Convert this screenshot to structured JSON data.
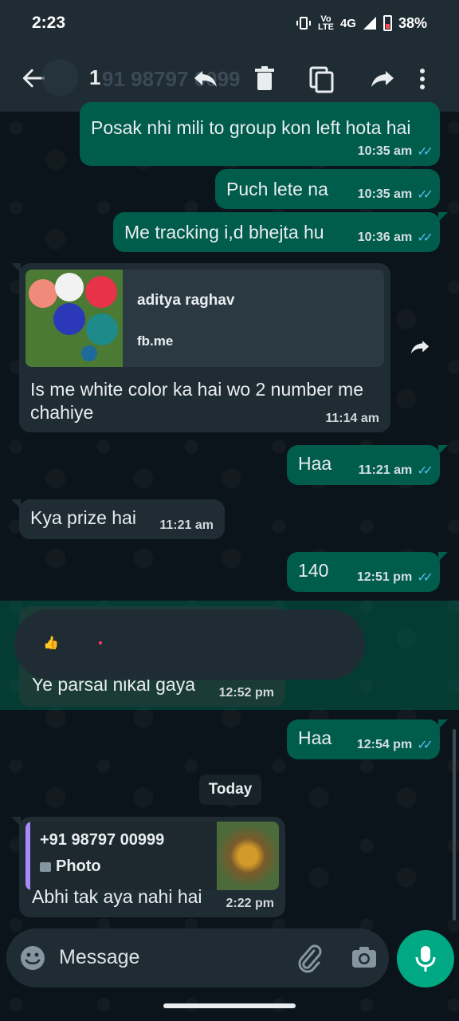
{
  "status_bar": {
    "time": "2:23",
    "network": "4G",
    "battery": "38%"
  },
  "action_bar": {
    "selected_count": "1",
    "contact_ghost": "91 98797 0099"
  },
  "messages": [
    {
      "text": "Posak nhi mili to group kon left hota hai",
      "time": "10:35 am",
      "ticks": "✓✓"
    },
    {
      "text": "Puch lete na",
      "time": "10:35 am",
      "ticks": "✓✓"
    },
    {
      "text": "Me tracking i,d bhejta hu",
      "time": "10:36 am",
      "ticks": "✓✓"
    },
    {
      "preview_name": "aditya raghav",
      "preview_domain": "fb.me",
      "text": "Is me white color ka hai wo 2 number me chahiye",
      "time": "11:14 am"
    },
    {
      "text": "Haa",
      "time": "11:21 am",
      "ticks": "✓✓"
    },
    {
      "text": "Kya prize hai",
      "time": "11:21 am"
    },
    {
      "text": "140",
      "time": "12:51 pm",
      "ticks": "✓✓"
    },
    {
      "text": "Ye parsal nikal gaya",
      "time": "12:52 pm"
    },
    {
      "text": "Haa",
      "time": "12:54 pm",
      "ticks": "✓✓"
    },
    {
      "quote_name": "+91 98797 00999",
      "quote_type": "Photo",
      "text": "Abhi tak aya nahi hai",
      "time": "2:22 pm"
    }
  ],
  "reaction_bar": {
    "emoji": "👍"
  },
  "day_divider": "Today",
  "composer": {
    "placeholder": "Message"
  },
  "colors": {
    "header": "#1f2c34",
    "outgoing_bubble": "#005c4b",
    "incoming_bubble": "#202c33",
    "accent": "#00a884",
    "read_ticks": "#53bdeb"
  },
  "icons": [
    "back-arrow-icon",
    "reply-icon",
    "delete-icon",
    "copy-icon",
    "forward-icon",
    "more-vertical-icon",
    "emoji-icon",
    "attach-icon",
    "camera-icon",
    "mic-icon"
  ]
}
